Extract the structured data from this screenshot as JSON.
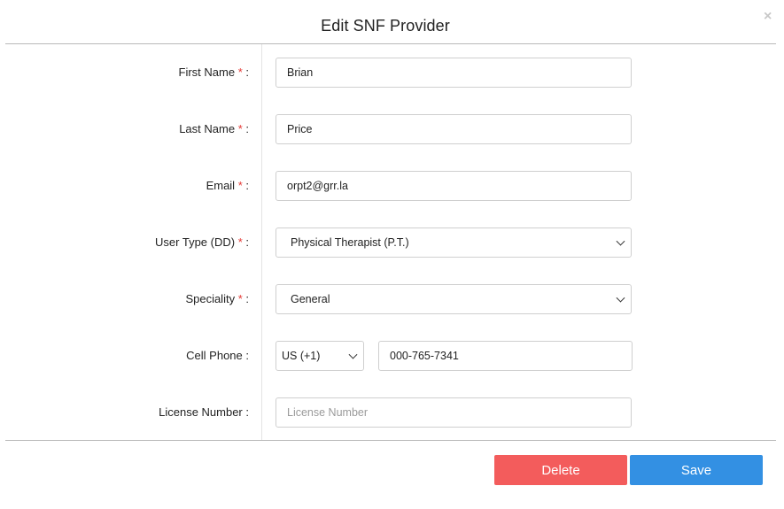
{
  "modal": {
    "title": "Edit SNF Provider",
    "close_icon": "×"
  },
  "form": {
    "required_mark": "*",
    "first_name": {
      "label": "First Name",
      "value": "Brian"
    },
    "last_name": {
      "label": "Last Name",
      "value": "Price"
    },
    "email": {
      "label": "Email",
      "value": "orpt2@grr.la"
    },
    "user_type": {
      "label": "User Type (DD)",
      "selected": "Physical Therapist (P.T.)"
    },
    "speciality": {
      "label": "Speciality",
      "selected": "General"
    },
    "cell_phone": {
      "label": "Cell Phone :",
      "country_code": "US (+1)",
      "value": "000-765-7341"
    },
    "license_number": {
      "label": "License Number :",
      "placeholder": "License Number"
    }
  },
  "footer": {
    "delete_label": "Delete",
    "save_label": "Save",
    "delete_color": "#f35c5c",
    "save_color": "#3390e3"
  },
  "icons": [
    "close-icon",
    "chevron-down-icon"
  ]
}
